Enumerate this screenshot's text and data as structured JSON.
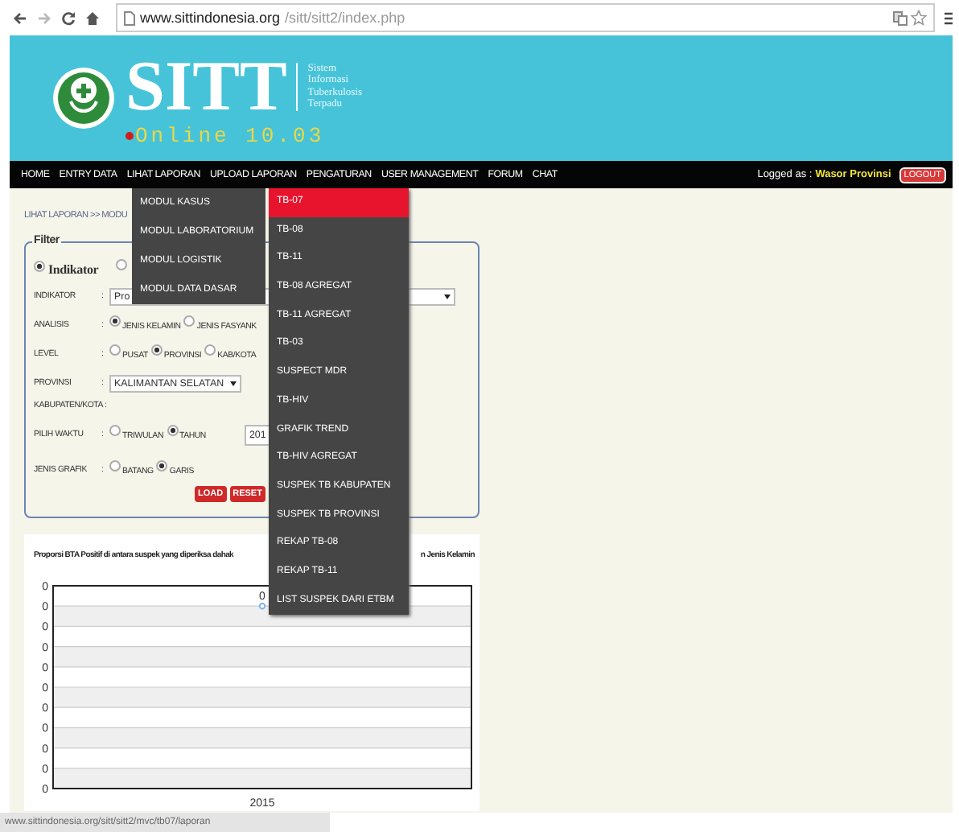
{
  "browser": {
    "url_host": "www.sittindonesia.org",
    "url_path": "/sitt/sitt2/index.php"
  },
  "header": {
    "title": "SITT",
    "tagline": [
      "Sistem",
      "Informasi",
      "Tuberkulosis",
      "Terpadu"
    ],
    "version": "Online 10.03"
  },
  "nav": {
    "items": [
      "HOME",
      "ENTRY DATA",
      "LIHAT LAPORAN",
      "UPLOAD LAPORAN",
      "PENGATURAN",
      "USER MANAGEMENT",
      "FORUM",
      "CHAT"
    ],
    "user_label": "Logged as :",
    "user_name": "Wasor Provinsi",
    "logout": "LOGOUT"
  },
  "breadcrumb": "LIHAT LAPORAN >> MODU",
  "filter": {
    "legend": "Filter",
    "modes": [
      {
        "label": "Indikator",
        "selected": true
      },
      {
        "selected": false
      }
    ],
    "rows": [
      {
        "kind": "wide-select",
        "label": "INDIKATOR",
        "separator": ":",
        "value": "Pro"
      },
      {
        "kind": "radio",
        "label": "ANALISIS",
        "separator": ":",
        "options": [
          {
            "label": "JENIS KELAMIN",
            "selected": true
          },
          {
            "label": "JENIS FASYANK",
            "selected": false
          }
        ]
      },
      {
        "kind": "radio",
        "label": "LEVEL",
        "separator": ":",
        "options": [
          {
            "label": "PUSAT",
            "selected": false
          },
          {
            "label": "PROVINSI",
            "selected": true
          },
          {
            "label": "KAB/KOTA",
            "selected": false
          }
        ]
      },
      {
        "kind": "select",
        "label": "PROVINSI",
        "separator": ":",
        "value": "KALIMANTAN SELATAN"
      },
      {
        "kind": "text",
        "label": "KABUPATEN/KOTA :"
      },
      {
        "kind": "radio-select",
        "label": "PILIH WAKTU",
        "separator": ":",
        "options": [
          {
            "label": "TRIWULAN",
            "selected": false
          },
          {
            "label": "TAHUN",
            "selected": true
          }
        ],
        "value": "201"
      },
      {
        "kind": "radio",
        "label": "JENIS GRAFIK",
        "separator": ":",
        "options": [
          {
            "label": "BATANG",
            "selected": false
          },
          {
            "label": "GARIS",
            "selected": true
          }
        ]
      }
    ],
    "buttons": [
      "LOAD",
      "RESET"
    ]
  },
  "chart_panel": {
    "title_start": "Proporsi BTA Positif di antara suspek yang diperiksa dahak",
    "title_end": "n Jenis Kelamin",
    "y_labels": [
      "0",
      "0",
      "0",
      "0",
      "0",
      "0",
      "0",
      "0",
      "0",
      "0",
      "0"
    ],
    "x_labels": [
      "2015"
    ],
    "point_label": "0"
  },
  "menu": [
    "MODUL KASUS",
    "MODUL LABORATORIUM",
    "MODUL LOGISTIK",
    "MODUL DATA DASAR"
  ],
  "submenu": [
    {
      "label": "TB-07",
      "selected": true
    },
    {
      "label": "TB-08",
      "selected": false
    },
    {
      "label": "TB-11",
      "selected": false
    },
    {
      "label": "TB-08 AGREGAT",
      "selected": false
    },
    {
      "label": "TB-11 AGREGAT",
      "selected": false
    },
    {
      "label": "TB-03",
      "selected": false
    },
    {
      "label": "SUSPECT MDR",
      "selected": false
    },
    {
      "label": "TB-HIV",
      "selected": false
    },
    {
      "label": "GRAFIK TREND",
      "selected": false
    },
    {
      "label": "TB-HIV AGREGAT",
      "selected": false
    },
    {
      "label": "SUSPEK TB KABUPATEN",
      "selected": false
    },
    {
      "label": "SUSPEK TB PROVINSI",
      "selected": false
    },
    {
      "label": "REKAP TB-08",
      "selected": false
    },
    {
      "label": "REKAP TB-11",
      "selected": false
    },
    {
      "label": "LIST SUSPEK DARI ETBM",
      "selected": false
    }
  ],
  "status_bar": "www.sittindonesia.org/sitt/sitt2/mvc/tb07/laporan"
}
